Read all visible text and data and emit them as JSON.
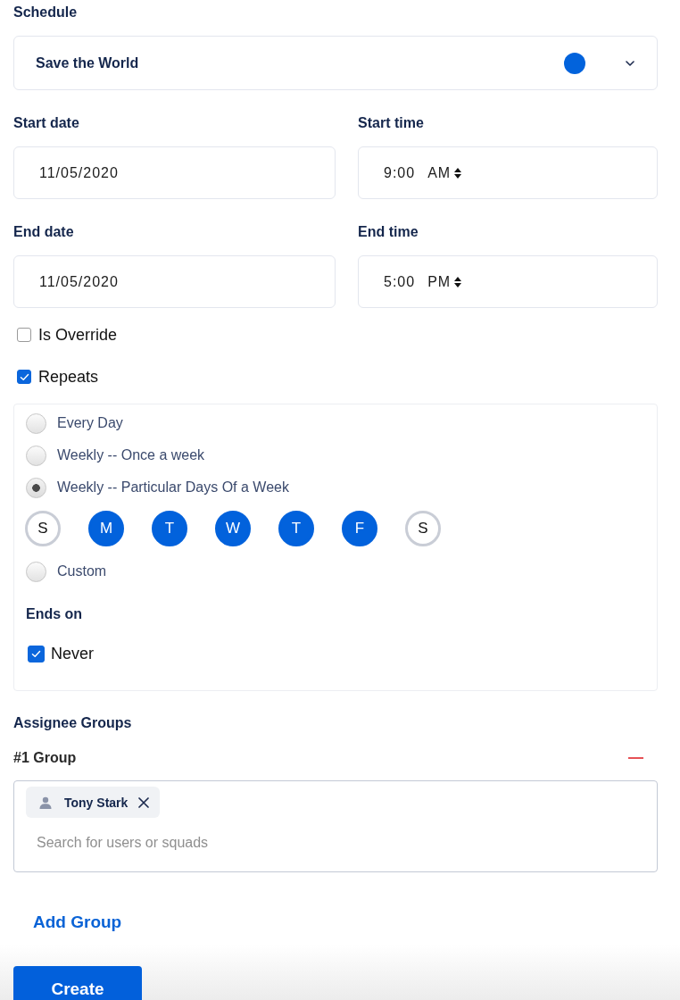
{
  "schedule": {
    "label": "Schedule",
    "value": "Save the World",
    "color": "#0263dc"
  },
  "fields": [
    {
      "label": "Start date",
      "kind": "date",
      "value": "11/05/2020"
    },
    {
      "label": "Start time",
      "kind": "time",
      "value": "9:00",
      "meridiem": "AM"
    },
    {
      "label": "End date",
      "kind": "date",
      "value": "11/05/2020"
    },
    {
      "label": "End time",
      "kind": "time",
      "value": "5:00",
      "meridiem": "PM"
    }
  ],
  "options": [
    {
      "label": "Is Override",
      "checked": false
    },
    {
      "label": "Repeats",
      "checked": true
    }
  ],
  "repeat": {
    "choices": [
      {
        "label": "Every Day",
        "selected": false
      },
      {
        "label": "Weekly -- Once a week",
        "selected": false
      },
      {
        "label": "Weekly -- Particular Days Of a Week",
        "selected": true,
        "days": [
          {
            "label": "S",
            "selected": false
          },
          {
            "label": "M",
            "selected": true
          },
          {
            "label": "T",
            "selected": true
          },
          {
            "label": "W",
            "selected": true
          },
          {
            "label": "T",
            "selected": true
          },
          {
            "label": "F",
            "selected": true
          },
          {
            "label": "S",
            "selected": false
          }
        ]
      },
      {
        "label": "Custom",
        "selected": false
      }
    ],
    "ends_on": {
      "label": "Ends on",
      "options": [
        {
          "label": "Never",
          "checked": true
        }
      ]
    }
  },
  "assignees": {
    "label": "Assignee Groups",
    "groups": [
      {
        "title": "#1 Group",
        "members": [
          {
            "name": "Tony Stark"
          }
        ],
        "placeholder": "Search for users or squads"
      }
    ],
    "add_label": "Add Group"
  },
  "submit": "Create"
}
